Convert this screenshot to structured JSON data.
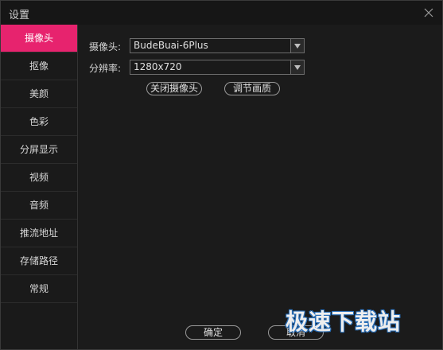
{
  "window": {
    "title": "设置"
  },
  "sidebar": {
    "items": [
      {
        "label": "摄像头",
        "active": true
      },
      {
        "label": "抠像"
      },
      {
        "label": "美颜"
      },
      {
        "label": "色彩"
      },
      {
        "label": "分屏显示"
      },
      {
        "label": "视频"
      },
      {
        "label": "音频"
      },
      {
        "label": "推流地址"
      },
      {
        "label": "存储路径"
      },
      {
        "label": "常规"
      }
    ]
  },
  "camera": {
    "camera_label": "摄像头:",
    "camera_value": "BudeBuai-6Plus",
    "resolution_label": "分辨率:",
    "resolution_value": "1280x720",
    "close_camera_label": "关闭摄像头",
    "adjust_quality_label": "调节画质"
  },
  "footer": {
    "ok_label": "确定",
    "cancel_label": "取消"
  },
  "watermark": {
    "text": "极速下载站"
  },
  "colors": {
    "accent": "#e7236e",
    "background": "#1b1b1b",
    "watermark_outline": "#2a6fb8"
  }
}
